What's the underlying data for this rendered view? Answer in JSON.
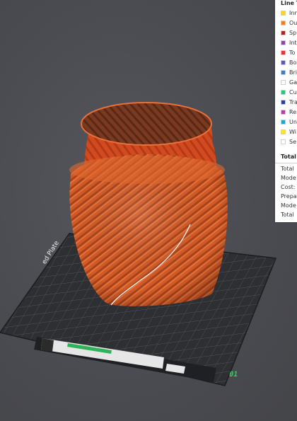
{
  "legend": {
    "title": "Line T",
    "items": [
      {
        "label": "Inn",
        "color": "#ffd21f"
      },
      {
        "label": "Ou",
        "color": "#ff7a1f"
      },
      {
        "label": "Sp",
        "color": "#b52222"
      },
      {
        "label": "Int",
        "color": "#8e44ad"
      },
      {
        "label": "To",
        "color": "#e53535"
      },
      {
        "label": "Bo",
        "color": "#5b5bb6"
      },
      {
        "label": "Bri",
        "color": "#3a7fc4"
      },
      {
        "label": "Ga",
        "color": "#ffffff"
      },
      {
        "label": "Cu",
        "color": "#2ec27e"
      },
      {
        "label": "Tra",
        "color": "#2b3f9c"
      },
      {
        "label": "Re",
        "color": "#b83fa0"
      },
      {
        "label": "Un",
        "color": "#1aa7d6"
      },
      {
        "label": "Wi",
        "color": "#ffe61f"
      },
      {
        "label": "Se",
        "color": "#ffffff"
      }
    ]
  },
  "totals": {
    "header": "Total",
    "rows": [
      "Total",
      "Mode",
      "Cost:",
      "Prepa",
      "Mode",
      "Total"
    ]
  },
  "plate": {
    "name_label": "ed Plate",
    "number": "01"
  },
  "model": {
    "color": "#d9602a"
  }
}
